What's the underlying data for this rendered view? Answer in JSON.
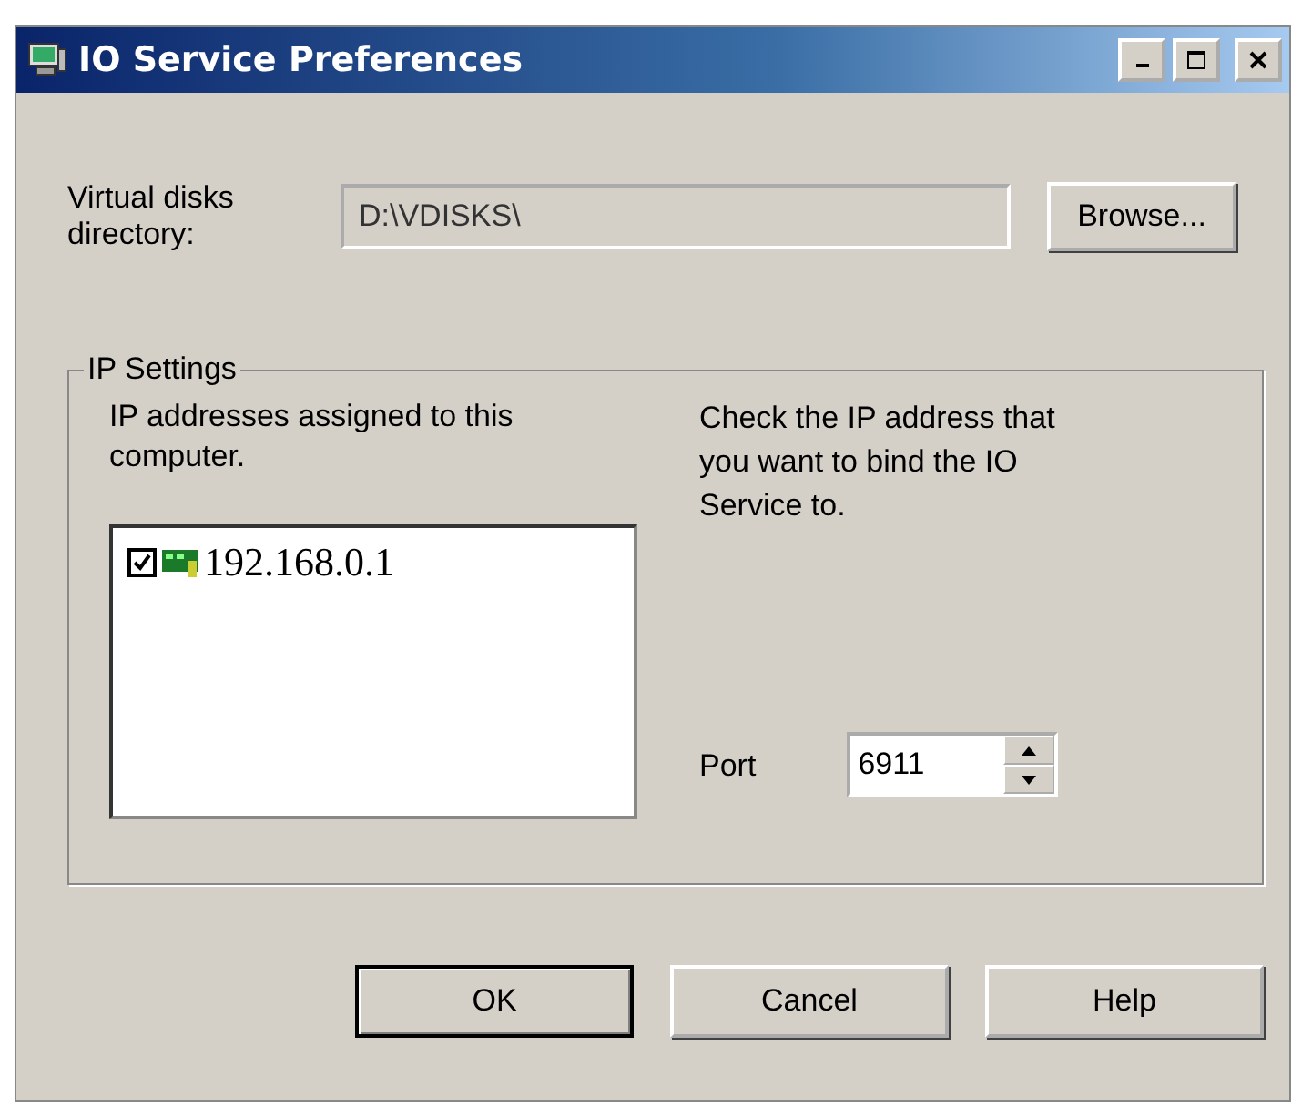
{
  "window": {
    "title": "IO Service Preferences"
  },
  "directory": {
    "label": "Virtual disks directory:",
    "value": "D:\\VDISKS\\",
    "button": "Browse..."
  },
  "ip_settings": {
    "title": "IP Settings",
    "list_label": "IP addresses assigned to this computer.",
    "hint": "Check the IP address that you want to bind the IO Service to.",
    "addresses": [
      {
        "address": "192.168.0.1",
        "checked": true
      }
    ],
    "port": {
      "label": "Port",
      "value": "6911"
    }
  },
  "buttons": [
    {
      "label": "OK",
      "default": true
    },
    {
      "label": "Cancel",
      "default": false
    },
    {
      "label": "Help",
      "default": false
    }
  ]
}
